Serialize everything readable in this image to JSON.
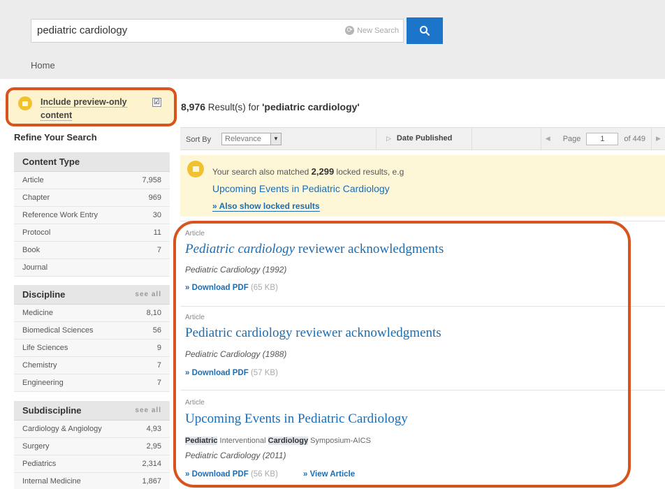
{
  "search": {
    "query": "pediatric cardiology",
    "new_search_label": "New Search",
    "button_glyph": "search-icon"
  },
  "breadcrumb": {
    "home": "Home"
  },
  "preview": {
    "label": "Include preview-only content",
    "checked": true,
    "check_glyph": "☑"
  },
  "sidebar": {
    "refine_title": "Refine Your Search",
    "facets": [
      {
        "title": "Content Type",
        "dots": "",
        "rows": [
          {
            "label": "Article",
            "count": "7,958"
          },
          {
            "label": "Chapter",
            "count": "969"
          },
          {
            "label": "Reference Work Entry",
            "count": "30"
          },
          {
            "label": "Protocol",
            "count": "11"
          },
          {
            "label": "Book",
            "count": "7"
          },
          {
            "label": "Journal",
            "count": ""
          }
        ]
      },
      {
        "title": "Discipline",
        "dots": "see all",
        "rows": [
          {
            "label": "Medicine",
            "count": "8,10"
          },
          {
            "label": "Biomedical Sciences",
            "count": "56"
          },
          {
            "label": "Life Sciences",
            "count": "9"
          },
          {
            "label": "Chemistry",
            "count": "7"
          },
          {
            "label": "Engineering",
            "count": "7"
          }
        ]
      },
      {
        "title": "Subdiscipline",
        "dots": "see all",
        "rows": [
          {
            "label": "Cardiology & Angiology",
            "count": "4,93"
          },
          {
            "label": "Surgery",
            "count": "2,95"
          },
          {
            "label": "Pediatrics",
            "count": "2,314"
          },
          {
            "label": "Internal Medicine",
            "count": "1,867"
          }
        ]
      }
    ]
  },
  "results": {
    "count": "8,976",
    "count_suffix": " Result(s) for ",
    "query_quoted": "'pediatric cardiology'",
    "sort_label": "Sort By",
    "sort_value": "Relevance",
    "date_published": "Date Published",
    "page_label": "Page",
    "page_value": "1",
    "page_of": "of 449"
  },
  "locked": {
    "text_before": "Your search also matched ",
    "count": "2,299",
    "text_after": " locked results, e.g",
    "example": "Upcoming Events in Pediatric Cardiology",
    "show_link": "» Also show locked results"
  },
  "items": [
    {
      "type": "Article",
      "title_em": "Pediatric cardiology",
      "title_rest": " reviewer acknowledgments",
      "snippet_a": "",
      "snippet_b": "",
      "snippet_c": "",
      "snippet_d": "",
      "source": "Pediatric Cardiology (1992)",
      "download": "» Download PDF",
      "size": "(65 KB)",
      "view": ""
    },
    {
      "type": "Article",
      "title_em": "",
      "title_rest": "Pediatric cardiology reviewer acknowledgments",
      "snippet_a": "",
      "snippet_b": "",
      "snippet_c": "",
      "snippet_d": "",
      "source": "Pediatric Cardiology (1988)",
      "download": "» Download PDF",
      "size": "(57 KB)",
      "view": ""
    },
    {
      "type": "Article",
      "title_em": "",
      "title_rest": "Upcoming Events in Pediatric Cardiology",
      "snippet_a": "Pediatric",
      "snippet_b": " Interventional ",
      "snippet_c": "Cardiology",
      "snippet_d": " Symposium-AICS",
      "source": "Pediatric Cardiology (2011)",
      "download": "» Download PDF",
      "size": "(56 KB)",
      "view": "» View Article"
    }
  ],
  "colors": {
    "accent": "#1c75c9",
    "link": "#1a6db5",
    "annotation_ring": "#d9531e",
    "locked_bg": "#fdf7d8"
  }
}
